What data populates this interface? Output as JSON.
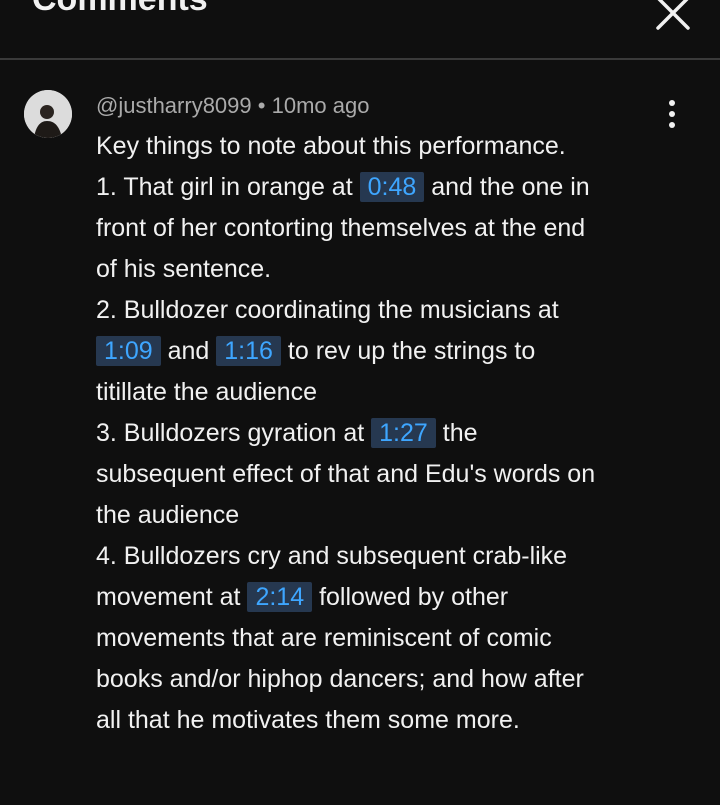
{
  "header": {
    "title": "Comments",
    "close_icon": "close-icon"
  },
  "comment": {
    "author": "@justharry8099",
    "separator": "•",
    "age": "10mo ago",
    "menu_icon": "more-vert-icon",
    "lines": [
      {
        "a": "Key things to note about this performance."
      },
      {
        "a": "1. That girl in orange at ",
        "t1": "0:48",
        "b": " and the one in"
      },
      {
        "a": "front of her contorting themselves at the end"
      },
      {
        "a": "of his sentence."
      },
      {
        "a": "2. Bulldozer coordinating the musicians at"
      },
      {
        "t1": "1:09",
        "b": " and ",
        "t2": "1:16",
        "c": " to rev up the strings to"
      },
      {
        "a": "titillate the audience"
      },
      {
        "a": "3. Bulldozers gyration at ",
        "t1": "1:27",
        "b": " the"
      },
      {
        "a": "subsequent effect of that and Edu's words on"
      },
      {
        "a": "the audience"
      },
      {
        "a": "4. Bulldozers cry and subsequent crab-like"
      },
      {
        "a": "movement at ",
        "t1": "2:14",
        "b": " followed by other"
      },
      {
        "a": "movements that are reminiscent of comic"
      },
      {
        "a": "books and/or hiphop dancers; and how after"
      },
      {
        "a": "all that he motivates them some more."
      }
    ]
  }
}
